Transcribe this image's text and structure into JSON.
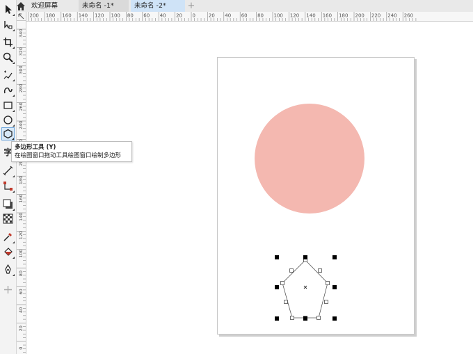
{
  "tabs": {
    "welcome": "欢迎屏幕",
    "doc1": "未命名 -1*",
    "doc2": "未命名 -2*",
    "add": "+"
  },
  "ruler_top": [
    "200",
    "180",
    "160",
    "140",
    "120",
    "100",
    "80",
    "60",
    "40",
    "20",
    "0",
    "20",
    "40",
    "60",
    "80",
    "100",
    "120",
    "140",
    "160",
    "180",
    "200",
    "220",
    "240",
    "260"
  ],
  "ruler_left": [
    "340",
    "320",
    "300",
    "280",
    "260",
    "240",
    "220",
    "200",
    "180",
    "160",
    "140",
    "120",
    "100",
    "80",
    "60",
    "40",
    "20",
    "0"
  ],
  "tooltip": {
    "title": "多边形工具 (Y)",
    "desc": "在绘图窗口拖动工具绘图窗口绘制多边形"
  },
  "tools": [
    {
      "name": "pick-tool",
      "icon": "arrow-pointer-icon"
    },
    {
      "name": "shape-tool",
      "icon": "node-edit-icon"
    },
    {
      "name": "crop-tool",
      "icon": "crop-icon"
    },
    {
      "name": "zoom-tool",
      "icon": "magnifier-icon"
    },
    {
      "name": "freehand-tool",
      "icon": "freehand-icon"
    },
    {
      "name": "artistic-media-tool",
      "icon": "curve-icon"
    },
    {
      "name": "rectangle-tool",
      "icon": "rectangle-icon"
    },
    {
      "name": "ellipse-tool",
      "icon": "ellipse-icon"
    },
    {
      "name": "polygon-tool",
      "icon": "polygon-icon"
    },
    {
      "name": "text-tool",
      "icon": "text-icon",
      "glyph": "字"
    },
    {
      "name": "parallel-dimension-tool",
      "icon": "dimension-icon"
    },
    {
      "name": "connector-tool",
      "icon": "connector-icon"
    },
    {
      "name": "drop-shadow-tool",
      "icon": "shadow-icon"
    },
    {
      "name": "transparency-tool",
      "icon": "checkerboard-icon"
    },
    {
      "name": "eyedropper-tool",
      "icon": "eyedropper-icon"
    },
    {
      "name": "interactive-fill-tool",
      "icon": "paint-bucket-icon"
    },
    {
      "name": "smart-fill-tool",
      "icon": "pen-nib-icon"
    },
    {
      "name": "add-tool",
      "icon": "plus-icon"
    }
  ],
  "colors": {
    "circle_fill": "#f4b8b0",
    "active_tab": "#cfe3f7",
    "accent": "#6fa6db"
  }
}
